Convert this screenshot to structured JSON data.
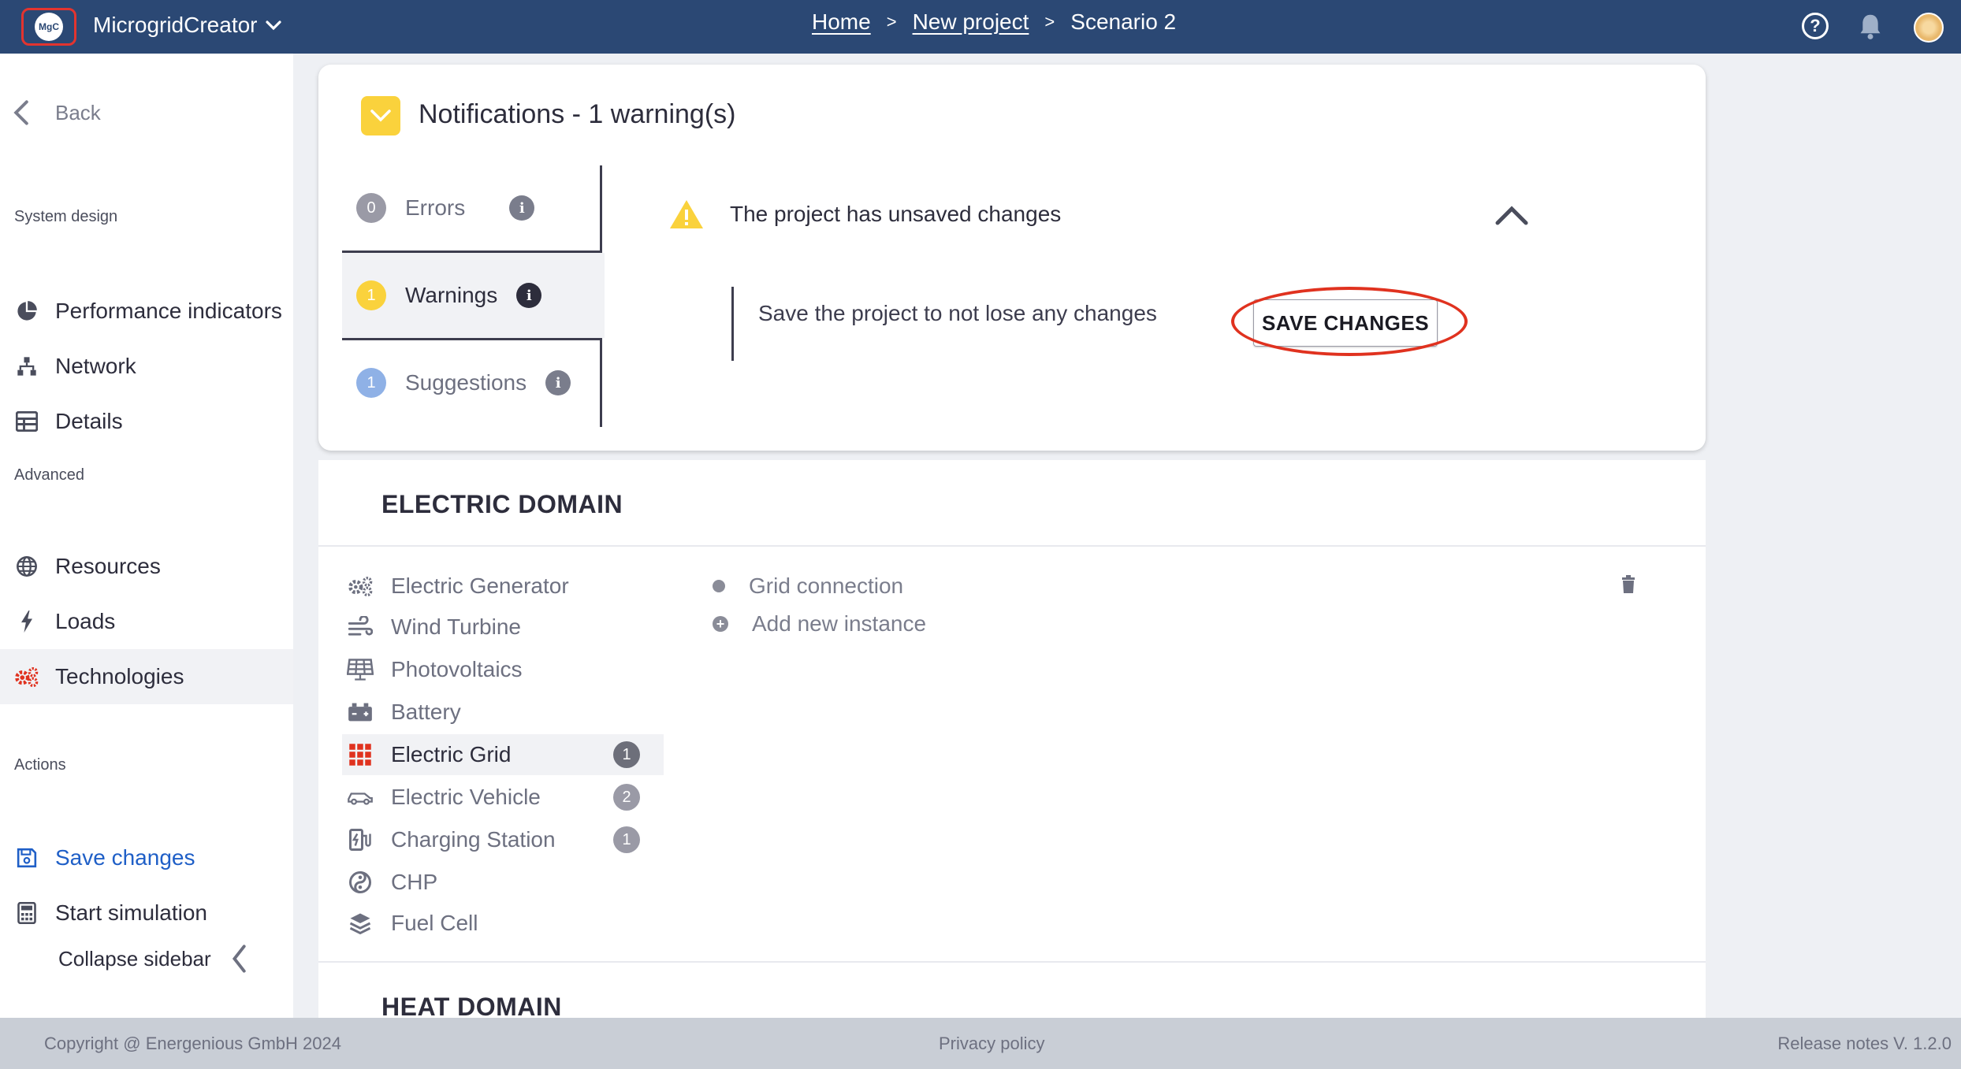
{
  "app": {
    "logo_text": "MgC",
    "name": "MicrogridCreator"
  },
  "breadcrumb": {
    "home": "Home",
    "sep1": ">",
    "project": "New project",
    "sep2": ">",
    "current": "Scenario 2"
  },
  "topbar": {
    "help_glyph": "?"
  },
  "sidebar": {
    "back_label": "Back",
    "system_design_label": "System design",
    "system_design_items": [
      {
        "label": "Performance indicators",
        "icon": "pie-chart-icon"
      },
      {
        "label": "Network",
        "icon": "network-icon"
      },
      {
        "label": "Details",
        "icon": "table-icon"
      }
    ],
    "advanced_label": "Advanced",
    "advanced_items": [
      {
        "label": "Resources",
        "icon": "globe-icon"
      },
      {
        "label": "Loads",
        "icon": "bolt-icon"
      },
      {
        "label": "Technologies",
        "icon": "gears-icon"
      }
    ],
    "actions_label": "Actions",
    "action_items": [
      {
        "label": "Save changes",
        "icon": "save-icon"
      },
      {
        "label": "Start simulation",
        "icon": "calculator-icon"
      }
    ],
    "collapse_label": "Collapse sidebar"
  },
  "notifications": {
    "title": "Notifications - 1 warning(s)",
    "tabs": [
      {
        "label": "Errors",
        "count": "0",
        "color": "#9a9aa6"
      },
      {
        "label": "Warnings",
        "count": "1",
        "color": "#fad23c"
      },
      {
        "label": "Suggestions",
        "count": "1",
        "color": "#8fb1e6"
      }
    ],
    "warning_message": "The project has unsaved changes",
    "warning_detail": "Save the project to not lose any changes",
    "save_button": "SAVE CHANGES",
    "accent_color": "#fad23c",
    "highlight_color": "#e0321f"
  },
  "electric_domain": {
    "title": "ELECTRIC DOMAIN",
    "technologies": [
      {
        "label": "Electric Generator",
        "icon": "generator-gears-icon",
        "count": ""
      },
      {
        "label": "Wind Turbine",
        "icon": "wind-icon",
        "count": ""
      },
      {
        "label": "Photovoltaics",
        "icon": "solar-panel-icon",
        "count": ""
      },
      {
        "label": "Battery",
        "icon": "battery-icon",
        "count": ""
      },
      {
        "label": "Electric Grid",
        "icon": "grid-icon",
        "count": "1"
      },
      {
        "label": "Electric Vehicle",
        "icon": "car-icon",
        "count": "2"
      },
      {
        "label": "Charging Station",
        "icon": "charging-station-icon",
        "count": "1"
      },
      {
        "label": "CHP",
        "icon": "chp-icon",
        "count": ""
      },
      {
        "label": "Fuel Cell",
        "icon": "layers-icon",
        "count": ""
      }
    ],
    "instances": [
      {
        "label": "Grid connection"
      }
    ],
    "add_instance_label": "Add new instance"
  },
  "heat_domain": {
    "title": "HEAT DOMAIN"
  },
  "footer": {
    "copyright": "Copyright @ Energenious GmbH 2024",
    "privacy": "Privacy policy",
    "release": "Release notes V. 1.2.0"
  }
}
